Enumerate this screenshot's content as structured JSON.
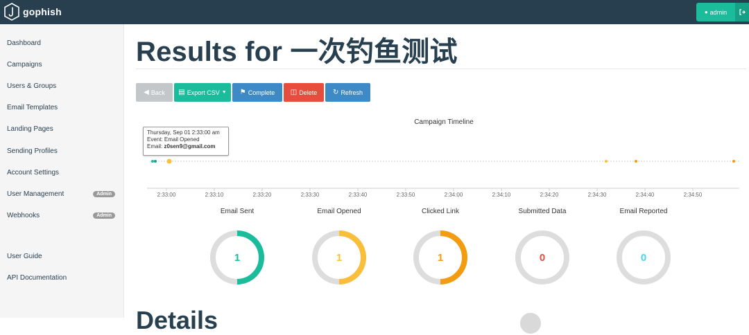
{
  "app": {
    "brand": "gophish"
  },
  "navbar": {
    "admin_label": "admin"
  },
  "sidebar": {
    "items": [
      {
        "label": "Dashboard"
      },
      {
        "label": "Campaigns"
      },
      {
        "label": "Users & Groups"
      },
      {
        "label": "Email Templates"
      },
      {
        "label": "Landing Pages"
      },
      {
        "label": "Sending Profiles"
      },
      {
        "label": "Account Settings"
      },
      {
        "label": "User Management",
        "badge": "Admin"
      },
      {
        "label": "Webhooks",
        "badge": "Admin"
      }
    ],
    "bottom_items": [
      {
        "label": "User Guide"
      },
      {
        "label": "API Documentation"
      }
    ]
  },
  "page": {
    "title": "Results for 一次钓鱼测试",
    "details_heading": "Details"
  },
  "toolbar": {
    "back": "Back",
    "export": "Export CSV",
    "complete": "Complete",
    "delete": "Delete",
    "refresh": "Refresh"
  },
  "timeline": {
    "title": "Campaign Timeline",
    "ticks": [
      "2:33:00",
      "2:33:10",
      "2:33:20",
      "2:33:30",
      "2:33:40",
      "2:33:50",
      "2:34:00",
      "2:34:10",
      "2:34:20",
      "2:34:30",
      "2:34:40",
      "2:34:50"
    ],
    "tooltip": {
      "line1": "Thursday, Sep 01 2:33:00 am",
      "line2": "Event: Email Opened",
      "line3_label": "Email: ",
      "line3_value": "z0sen9@gmail.com"
    },
    "colors": {
      "sent": "#1abc9c",
      "opened": "#f9bf3b",
      "clicked": "#f39c12"
    }
  },
  "stats": [
    {
      "label": "Email Sent",
      "value": "1",
      "fraction": 0.5,
      "color": "#1abc9c",
      "text_color": "#1abc9c"
    },
    {
      "label": "Email Opened",
      "value": "1",
      "fraction": 0.5,
      "color": "#f9bf3b",
      "text_color": "#f9bf3b"
    },
    {
      "label": "Clicked Link",
      "value": "1",
      "fraction": 0.5,
      "color": "#f39c12",
      "text_color": "#f39c12"
    },
    {
      "label": "Submitted Data",
      "value": "0",
      "fraction": 0,
      "color": "#f05b4f",
      "text_color": "#e74c3c"
    },
    {
      "label": "Email Reported",
      "value": "0",
      "fraction": 0,
      "color": "#45d6ef",
      "text_color": "#45d6ef"
    }
  ]
}
